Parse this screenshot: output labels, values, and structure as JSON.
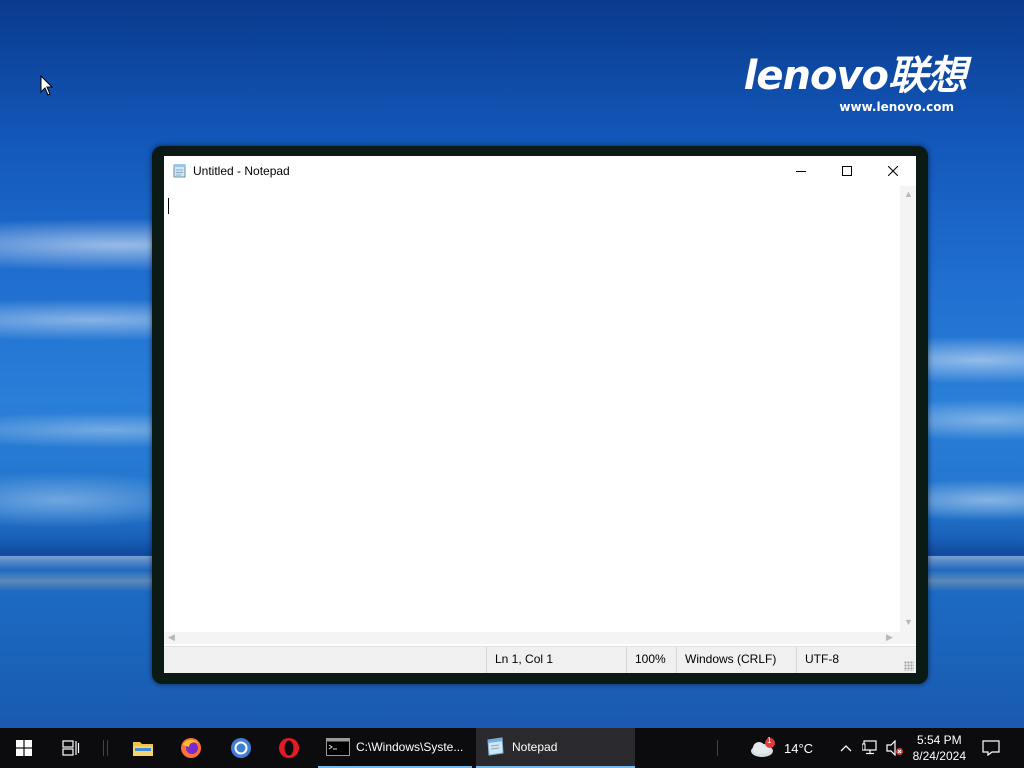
{
  "desktop": {
    "brand_logo": "lenovo联想",
    "brand_url": "www.lenovo.com"
  },
  "notepad": {
    "title": "Untitled - Notepad",
    "content": "",
    "status": {
      "position": "Ln 1, Col 1",
      "zoom": "100%",
      "line_ending": "Windows (CRLF)",
      "encoding": "UTF-8"
    }
  },
  "taskbar": {
    "pinned": [
      "start-icon",
      "task-view-icon",
      "file-explorer-icon",
      "firefox-icon",
      "chrome-icon",
      "opera-icon"
    ],
    "windows": [
      {
        "label": "C:\\Windows\\Syste...",
        "icon": "cmd-icon",
        "active": false
      },
      {
        "label": "Notepad",
        "icon": "notepad-icon",
        "active": true
      }
    ],
    "weather": {
      "temp": "14°C",
      "badge": "1"
    },
    "clock": {
      "time": "5:54 PM",
      "date": "8/24/2024"
    }
  },
  "colors": {
    "taskbar_bg": "#0c0c0e",
    "active_indicator": "#76b9ed",
    "window_frame": "#0b1a14"
  }
}
